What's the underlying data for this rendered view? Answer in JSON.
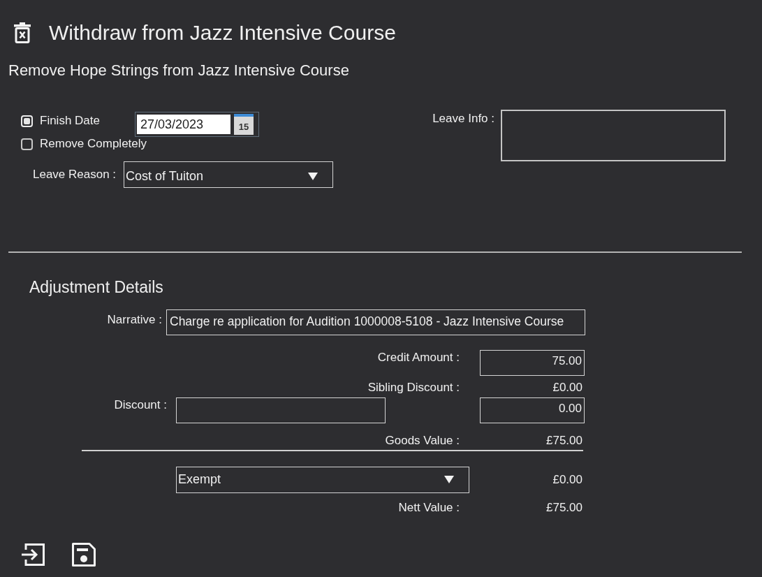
{
  "header": {
    "title": "Withdraw from Jazz Intensive Course",
    "subtitle": "Remove Hope Strings from Jazz Intensive Course"
  },
  "withdrawal": {
    "end_options": [
      {
        "label": "Finish Date",
        "selected": true
      },
      {
        "label": "Remove Completely",
        "selected": false
      }
    ],
    "finish_date": {
      "value": "27/03/2023",
      "calendar_day": "15"
    },
    "leave_reason": {
      "label": "Leave Reason :",
      "value": "Cost of Tuiton"
    },
    "leave_info": {
      "label": "Leave Info :"
    }
  },
  "adjustment": {
    "title": "Adjustment Details",
    "narrative": {
      "label": "Narrative :",
      "value": "Charge re application for Audition 1000008-5108 - Jazz Intensive Course"
    },
    "credit_amount": {
      "label": "Credit Amount :",
      "value": "75.00"
    },
    "sibling_discount": {
      "label": "Sibling Discount :",
      "value": "£0.00"
    },
    "discount": {
      "label": "Discount :",
      "value": "0.00"
    },
    "goods_value": {
      "label": "Goods Value :",
      "value": "£75.00"
    },
    "tax": {
      "value": "Exempt",
      "amount": "£0.00"
    },
    "nett_value": {
      "label": "Nett Value :",
      "value": "£75.00"
    }
  }
}
